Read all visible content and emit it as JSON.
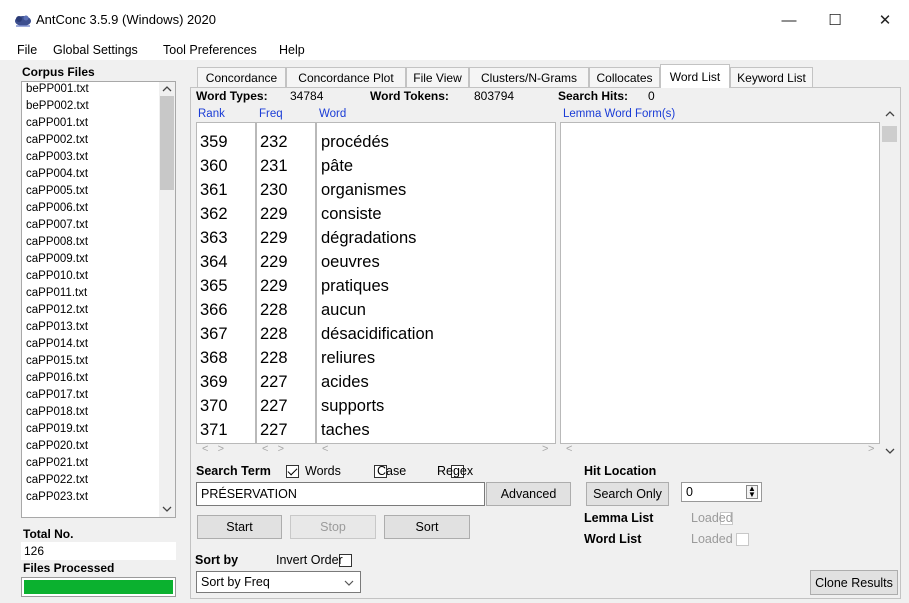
{
  "window": {
    "title": "AntConc 3.5.9 (Windows) 2020",
    "min_glyph": "—",
    "max_glyph": "☐",
    "close_glyph": "✕"
  },
  "menu": [
    "File",
    "Global Settings",
    "Tool Preferences",
    "Help"
  ],
  "left_panel": {
    "corpus_files_label": "Corpus Files",
    "files": [
      "bePP001.txt",
      "bePP002.txt",
      "caPP001.txt",
      "caPP002.txt",
      "caPP003.txt",
      "caPP004.txt",
      "caPP005.txt",
      "caPP006.txt",
      "caPP007.txt",
      "caPP008.txt",
      "caPP009.txt",
      "caPP010.txt",
      "caPP011.txt",
      "caPP012.txt",
      "caPP013.txt",
      "caPP014.txt",
      "caPP015.txt",
      "caPP016.txt",
      "caPP017.txt",
      "caPP018.txt",
      "caPP019.txt",
      "caPP020.txt",
      "caPP021.txt",
      "caPP022.txt",
      "caPP023.txt"
    ],
    "total_label": "Total No.",
    "total_value": "126",
    "files_processed_label": "Files Processed",
    "progress": 1.0,
    "progress_color": "#0bb12f"
  },
  "tabs": [
    "Concordance",
    "Concordance Plot",
    "File View",
    "Clusters/N-Grams",
    "Collocates",
    "Word List",
    "Keyword List"
  ],
  "active_tab": "Word List",
  "stats": {
    "types_label": "Word Types:",
    "types_value": "34784",
    "tokens_label": "Word Tokens:",
    "tokens_value": "803794",
    "hits_label": "Search Hits:",
    "hits_value": "0"
  },
  "columns": {
    "rank": "Rank",
    "freq": "Freq",
    "word": "Word",
    "lemma": "Lemma Word Form(s)"
  },
  "rows": [
    {
      "rank": "359",
      "freq": "232",
      "word": "procédés"
    },
    {
      "rank": "360",
      "freq": "231",
      "word": "pâte"
    },
    {
      "rank": "361",
      "freq": "230",
      "word": "organismes"
    },
    {
      "rank": "362",
      "freq": "229",
      "word": "consiste"
    },
    {
      "rank": "363",
      "freq": "229",
      "word": "dégradations"
    },
    {
      "rank": "364",
      "freq": "229",
      "word": "oeuvres"
    },
    {
      "rank": "365",
      "freq": "229",
      "word": "pratiques"
    },
    {
      "rank": "366",
      "freq": "228",
      "word": "aucun"
    },
    {
      "rank": "367",
      "freq": "228",
      "word": "désacidification"
    },
    {
      "rank": "368",
      "freq": "228",
      "word": "reliures"
    },
    {
      "rank": "369",
      "freq": "227",
      "word": "acides"
    },
    {
      "rank": "370",
      "freq": "227",
      "word": "supports"
    },
    {
      "rank": "371",
      "freq": "227",
      "word": "taches"
    }
  ],
  "search": {
    "term_label": "Search Term",
    "words_label": "Words",
    "words_checked": true,
    "case_label": "Case",
    "case_checked": false,
    "regex_label": "Regex",
    "regex_checked": false,
    "value": "PRÉSERVATION",
    "advanced_label": "Advanced"
  },
  "buttons": {
    "start": "Start",
    "stop": "Stop",
    "sort": "Sort",
    "clone": "Clone Results"
  },
  "hit_location": {
    "label": "Hit Location",
    "search_only": "Search Only",
    "value": "0"
  },
  "lemma_list": {
    "label": "Lemma List",
    "status": "Loaded"
  },
  "word_list": {
    "label": "Word List",
    "status": "Loaded"
  },
  "sort_by": {
    "label": "Sort by",
    "invert_label": "Invert Order",
    "invert_checked": false,
    "selected": "Sort by Freq"
  }
}
